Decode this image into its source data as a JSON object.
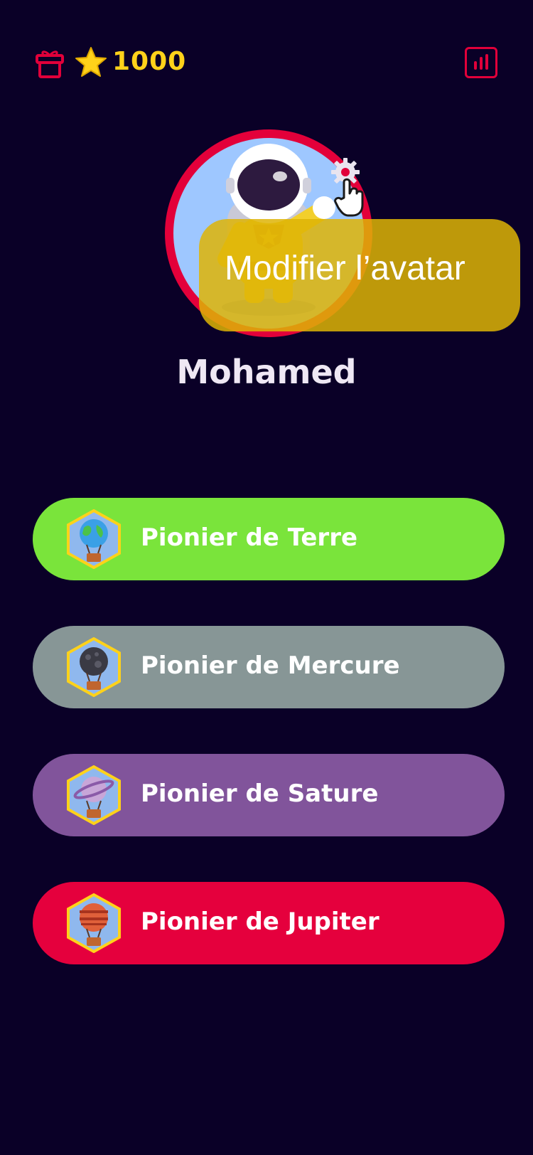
{
  "header": {
    "gift_icon": "gift-box-icon",
    "star_icon": "star-icon",
    "coins": "1000",
    "stats_icon": "bar-chart-icon",
    "accent_color": "#e1003a",
    "coin_color": "#ffd21a"
  },
  "profile": {
    "avatar_icon": "astronaut-avatar",
    "edit_icon": "gear-icon",
    "tooltip": "Modifier l’avatar",
    "name": "Mohamed"
  },
  "badges": [
    {
      "label": "Pionier de Terre",
      "color": "#7ae43b",
      "icon": "earth-balloon-icon"
    },
    {
      "label": "Pionier de Mercure",
      "color": "#879696",
      "icon": "mercury-balloon-icon"
    },
    {
      "label": "Pionier de Sature",
      "color": "#81549b",
      "icon": "saturn-balloon-icon"
    },
    {
      "label": "Pionier de Jupiter",
      "color": "#e5003d",
      "icon": "jupiter-balloon-icon"
    }
  ]
}
